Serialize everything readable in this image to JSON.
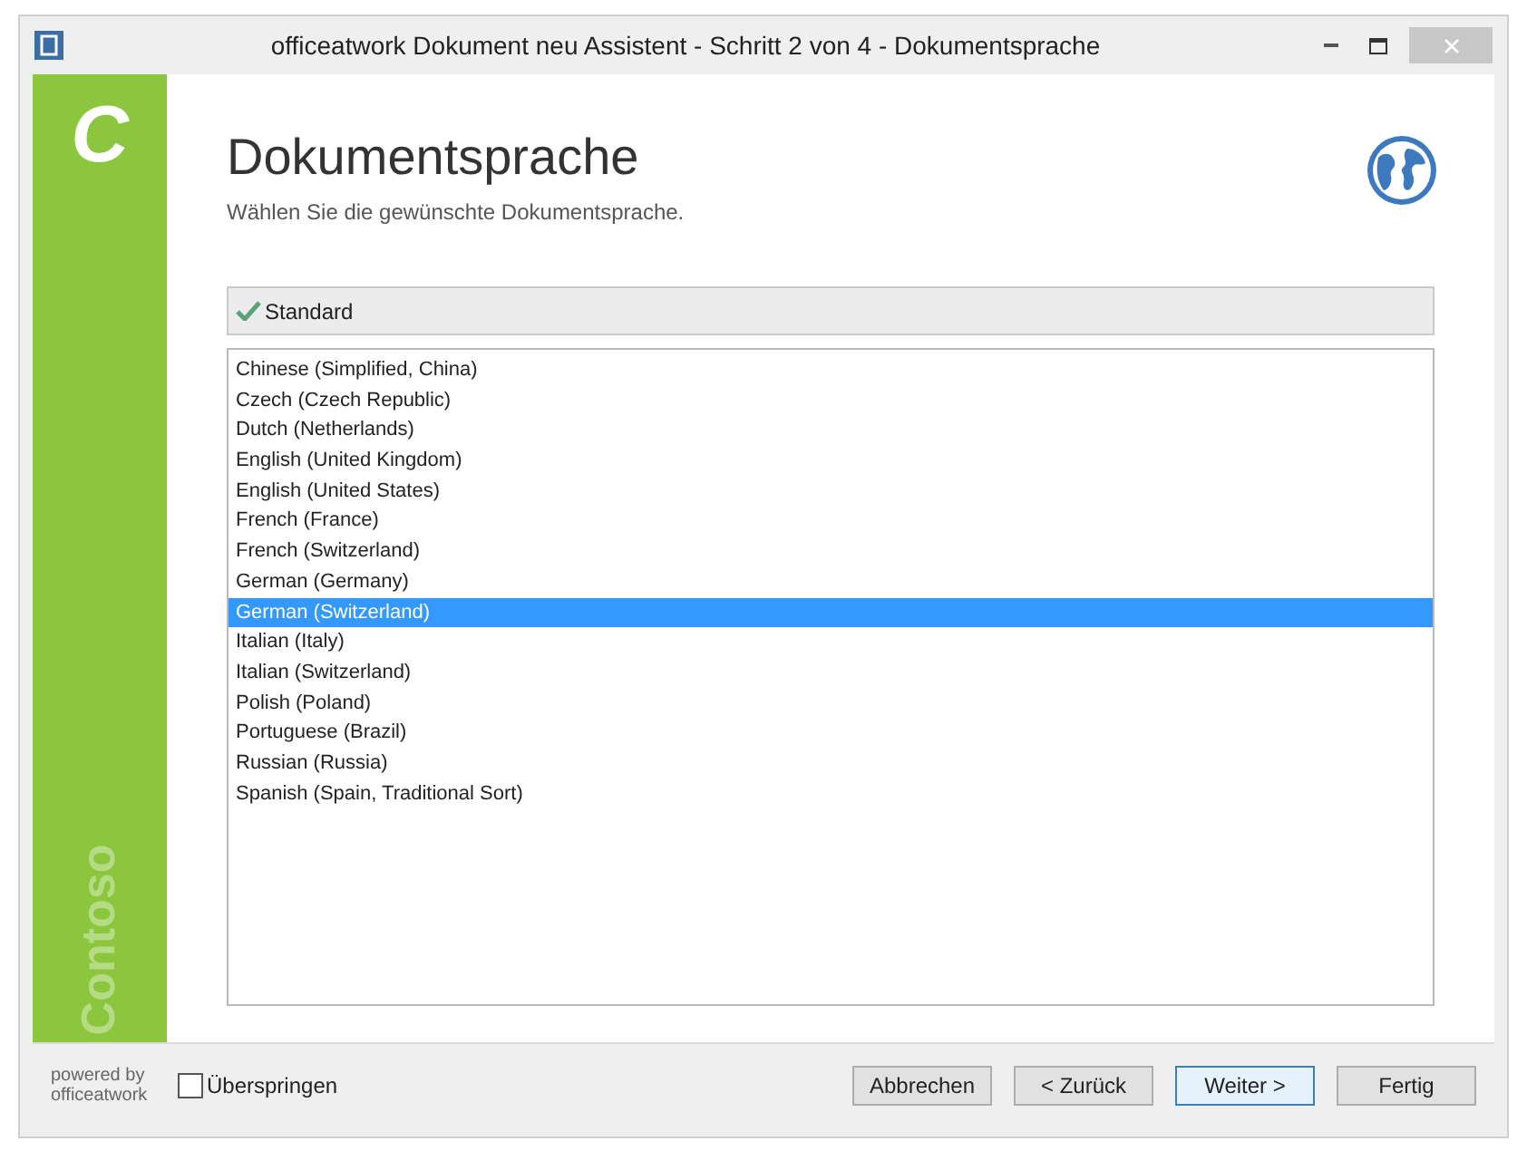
{
  "window": {
    "title": "officeatwork Dokument neu Assistent - Schritt 2 von 4 - Dokumentsprache"
  },
  "sidebar": {
    "logo_letter": "C",
    "brand": "Contoso"
  },
  "header": {
    "title": "Dokumentsprache",
    "subtitle": "Wählen Sie die gewünschte Dokumentsprache."
  },
  "standard_bar": {
    "label": "Standard",
    "checked": true
  },
  "languages": [
    {
      "label": "Chinese (Simplified, China)",
      "selected": false
    },
    {
      "label": "Czech (Czech Republic)",
      "selected": false
    },
    {
      "label": "Dutch (Netherlands)",
      "selected": false
    },
    {
      "label": "English (United Kingdom)",
      "selected": false
    },
    {
      "label": "English (United States)",
      "selected": false
    },
    {
      "label": "French (France)",
      "selected": false
    },
    {
      "label": "French (Switzerland)",
      "selected": false
    },
    {
      "label": "German (Germany)",
      "selected": false
    },
    {
      "label": "German (Switzerland)",
      "selected": true
    },
    {
      "label": "Italian (Italy)",
      "selected": false
    },
    {
      "label": "Italian (Switzerland)",
      "selected": false
    },
    {
      "label": "Polish (Poland)",
      "selected": false
    },
    {
      "label": "Portuguese (Brazil)",
      "selected": false
    },
    {
      "label": "Russian (Russia)",
      "selected": false
    },
    {
      "label": "Spanish (Spain, Traditional Sort)",
      "selected": false
    }
  ],
  "footer": {
    "powered_by": [
      "powered by",
      "officeatwork"
    ],
    "skip": {
      "label": "Überspringen",
      "checked": false
    },
    "buttons": [
      {
        "label": "Abbrechen",
        "default": false
      },
      {
        "label": "< Zurück",
        "default": false
      },
      {
        "label": "Weiter >",
        "default": true
      },
      {
        "label": "Fertig",
        "default": false
      }
    ]
  }
}
